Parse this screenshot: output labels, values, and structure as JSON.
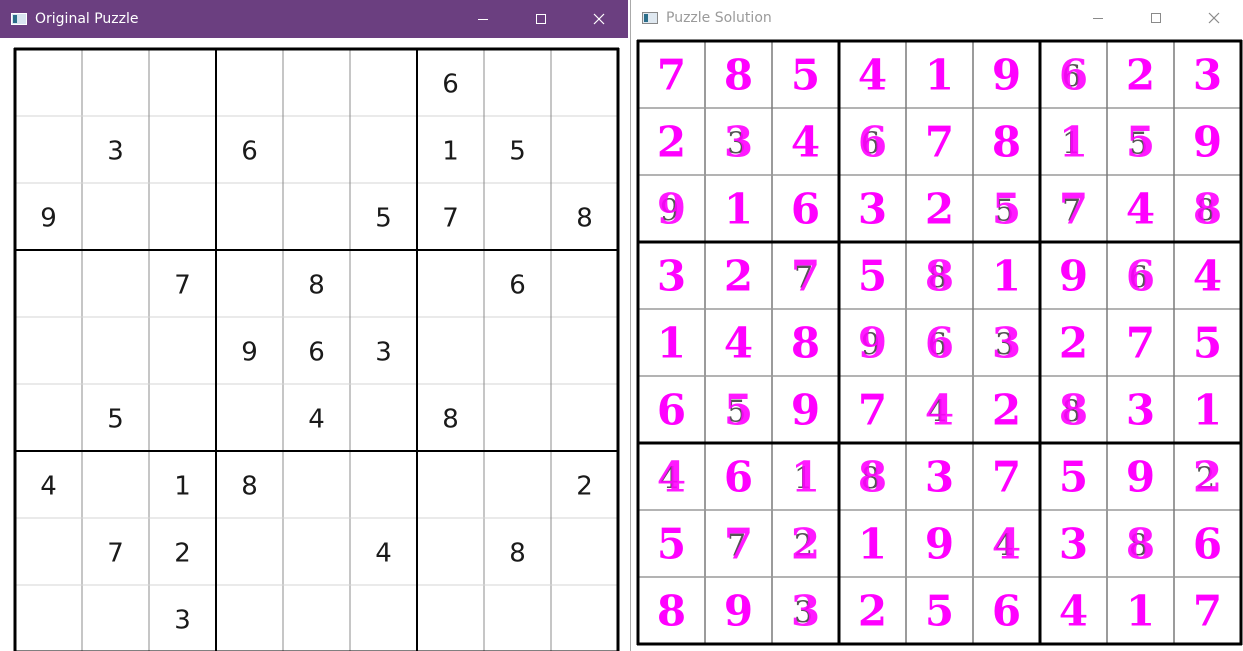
{
  "left_window": {
    "title": "Original Puzzle",
    "grid": [
      [
        null,
        null,
        null,
        null,
        null,
        null,
        6,
        null,
        null
      ],
      [
        null,
        3,
        null,
        6,
        null,
        null,
        1,
        5,
        null
      ],
      [
        9,
        null,
        null,
        null,
        null,
        5,
        7,
        null,
        8
      ],
      [
        null,
        null,
        7,
        null,
        8,
        null,
        null,
        6,
        null
      ],
      [
        null,
        null,
        null,
        9,
        6,
        3,
        null,
        null,
        null
      ],
      [
        null,
        5,
        null,
        null,
        4,
        null,
        8,
        null,
        null
      ],
      [
        4,
        null,
        1,
        8,
        null,
        null,
        null,
        null,
        2
      ],
      [
        null,
        7,
        2,
        null,
        null,
        4,
        null,
        8,
        null
      ],
      [
        null,
        null,
        3,
        null,
        null,
        null,
        null,
        null,
        null
      ]
    ],
    "digit_color": "#1a1a1a"
  },
  "right_window": {
    "title": "Puzzle Solution",
    "grid": [
      [
        7,
        8,
        5,
        4,
        1,
        9,
        6,
        2,
        3
      ],
      [
        2,
        3,
        4,
        6,
        7,
        8,
        1,
        5,
        9
      ],
      [
        9,
        1,
        6,
        3,
        2,
        5,
        7,
        4,
        8
      ],
      [
        3,
        2,
        7,
        5,
        8,
        1,
        9,
        6,
        4
      ],
      [
        1,
        4,
        8,
        9,
        6,
        3,
        2,
        7,
        5
      ],
      [
        6,
        5,
        9,
        7,
        4,
        2,
        8,
        3,
        1
      ],
      [
        4,
        6,
        1,
        8,
        3,
        7,
        5,
        9,
        2
      ],
      [
        5,
        7,
        2,
        1,
        9,
        4,
        3,
        8,
        6
      ],
      [
        8,
        9,
        3,
        2,
        5,
        6,
        4,
        1,
        7
      ]
    ],
    "solution_color": "#ff00ff",
    "given_digit_color": "#555555"
  },
  "window_controls": {
    "minimize_icon": "minimize-icon",
    "maximize_icon": "maximize-icon",
    "close_icon": "close-icon"
  },
  "colors": {
    "left_titlebar": "#6b3f80",
    "grid_line": "#000000"
  }
}
